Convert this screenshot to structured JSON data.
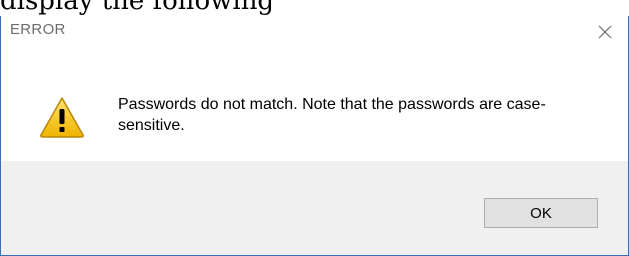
{
  "background_caption": "display the following",
  "dialog": {
    "title": "ERROR",
    "close_icon": "close-icon",
    "warning_icon": "warning-icon",
    "message": "Passwords do not match. Note that the passwords are case-sensitive.",
    "ok_label": "OK"
  },
  "colors": {
    "border": "#3a6fb7",
    "title_text": "#6d6d6d",
    "footer_background": "#f0f0f0",
    "button_background": "#e1e1e1",
    "button_border": "#adadad",
    "warning_fill": "#f4c21c",
    "warning_outline": "#b8860b"
  }
}
